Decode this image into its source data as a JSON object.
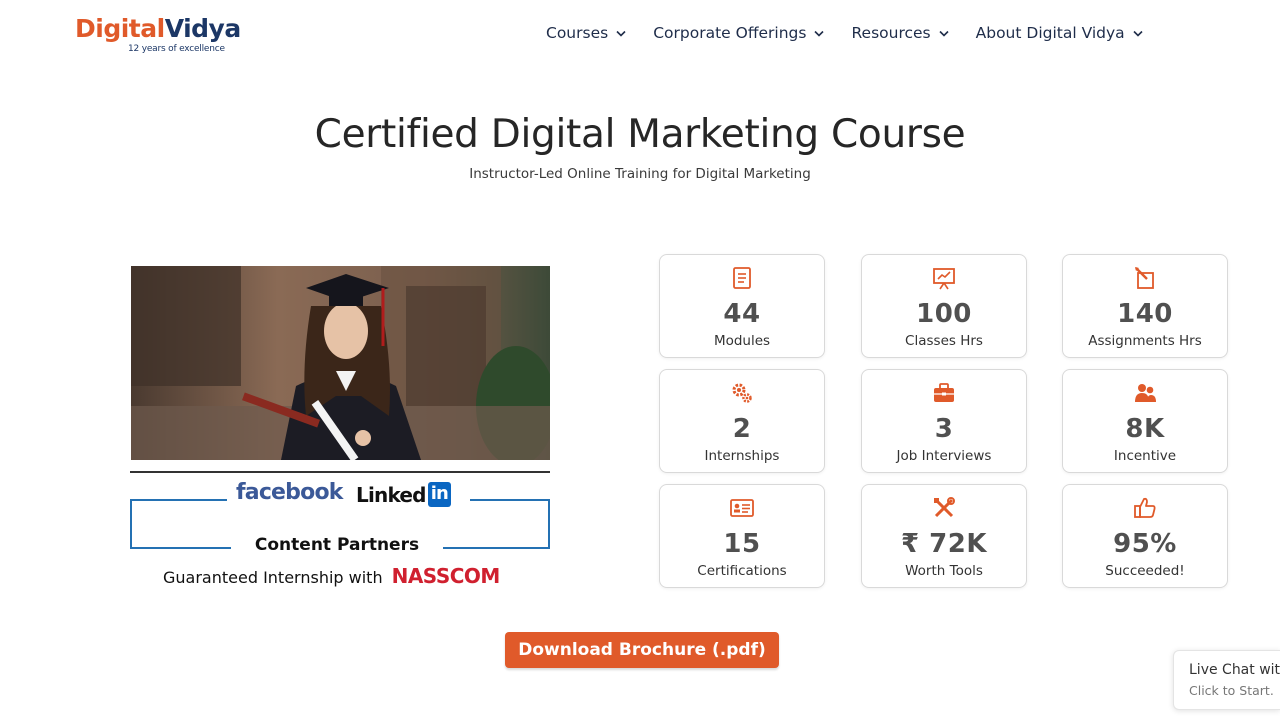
{
  "brand": {
    "name_part1": "Digital",
    "name_part2": "Vidya",
    "tagline": "12 years of excellence",
    "accent_color": "#e05a2a",
    "navy_color": "#1c3766"
  },
  "nav": {
    "items": [
      {
        "label": "Courses"
      },
      {
        "label": "Corporate Offerings"
      },
      {
        "label": "Resources"
      },
      {
        "label": "About Digital Vidya"
      }
    ]
  },
  "hero": {
    "title": "Certified Digital Marketing Course",
    "subtitle": "Instructor-Led Online Training for Digital Marketing"
  },
  "partners": {
    "facebook": "facebook",
    "linkedin_word": "Linked",
    "linkedin_in": "in",
    "content_partners": "Content Partners",
    "guaranteed": "Guaranteed Internship with",
    "nasscom": "NASSCOM"
  },
  "stats": [
    {
      "icon": "document-icon",
      "value": "44",
      "label": "Modules"
    },
    {
      "icon": "presentation-chart-icon",
      "value": "100",
      "label": "Classes Hrs"
    },
    {
      "icon": "pencil-edit-icon",
      "value": "140",
      "label": "Assignments Hrs"
    },
    {
      "icon": "gears-icon",
      "value": "2",
      "label": "Internships"
    },
    {
      "icon": "briefcase-icon",
      "value": "3",
      "label": "Job Interviews"
    },
    {
      "icon": "users-icon",
      "value": "8K",
      "label": "Incentive"
    },
    {
      "icon": "certificate-card-icon",
      "value": "15",
      "label": "Certifications"
    },
    {
      "icon": "tools-icon",
      "value": "₹ 72K",
      "label": "Worth Tools"
    },
    {
      "icon": "thumbs-up-icon",
      "value": "95%",
      "label": "Succeeded!"
    }
  ],
  "cta": {
    "label": "Download Brochure (.pdf)"
  },
  "chat": {
    "title": "Live Chat with",
    "subtitle": "Click to Start."
  }
}
